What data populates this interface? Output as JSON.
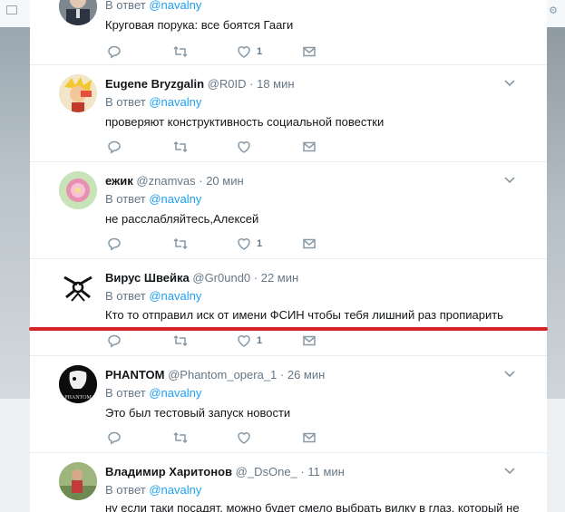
{
  "reply_prefix": "В ответ",
  "tweets": [
    {
      "name": "",
      "handle": "",
      "time": "",
      "reply_mention": "@navalny",
      "text": "Круговая порука: все боятся Гааги",
      "likes": "1"
    },
    {
      "name": "Eugene Bryzgalin",
      "handle": "@R0ID",
      "time": "· 18 мин",
      "reply_mention": "@navalny",
      "text": "проверяют конструктивность социальной повестки",
      "likes": ""
    },
    {
      "name": "ежик",
      "handle": "@znamvas",
      "time": "· 20 мин",
      "reply_mention": "@navalny",
      "text": "не расслабляйтесь,Алексей",
      "likes": "1"
    },
    {
      "name": "Вирус Швейка",
      "handle": "@Gr0und0",
      "time": "· 22 мин",
      "reply_mention": "@navalny",
      "text": "Кто то отправил иск от имени ФСИН чтобы тебя лишний раз пропиарить",
      "likes": "1"
    },
    {
      "name": "PHANTOM",
      "handle": "@Phantom_opera_1",
      "time": "· 26 мин",
      "reply_mention": "@navalny",
      "text": "Это был тестовый запуск новости",
      "likes": ""
    },
    {
      "name": "Владимир Харитонов",
      "handle": "@_DsOne_",
      "time": "· 11 мин",
      "reply_mention": "@navalny",
      "text": "ну если таки посадят, можно будет смело выбрать вилку в глаз, который не",
      "likes": ""
    }
  ],
  "colors": {
    "accent": "#1da1f2",
    "highlight_line": "#d42426",
    "text": "#14171a",
    "muted": "#657786"
  }
}
